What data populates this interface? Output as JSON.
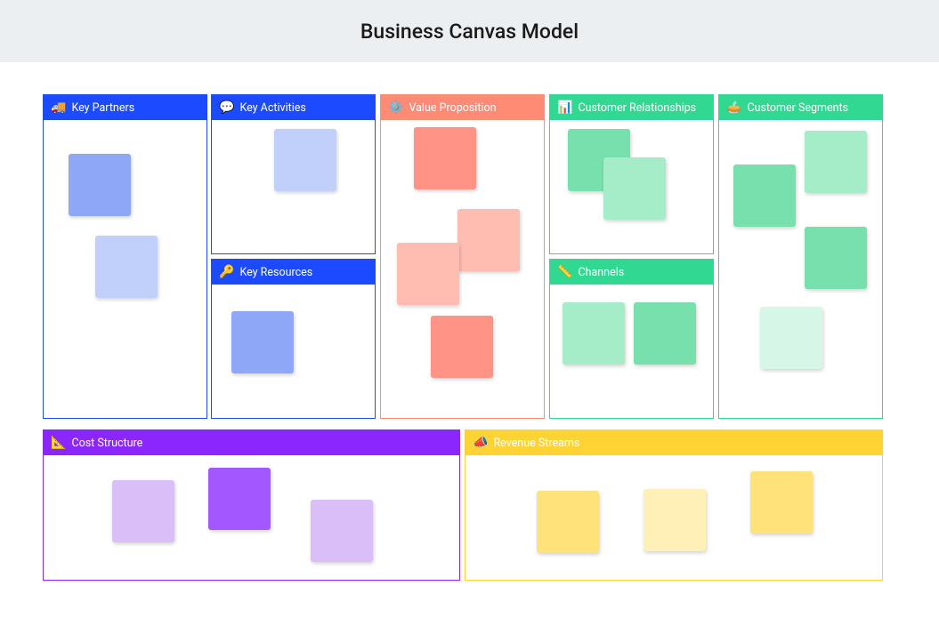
{
  "header": {
    "title": "Business Canvas Model"
  },
  "sections": {
    "key_partners": {
      "title": "Key Partners",
      "icon": "🚚"
    },
    "key_activities": {
      "title": "Key Activities",
      "icon": "💬"
    },
    "key_resources": {
      "title": "Key Resources",
      "icon": "🔑"
    },
    "value_proposition": {
      "title": "Value Proposition",
      "icon": "⚙️"
    },
    "customer_relationships": {
      "title": "Customer Relationships",
      "icon": "📊"
    },
    "channels": {
      "title": "Channels",
      "icon": "📏"
    },
    "customer_segments": {
      "title": "Customer Segments",
      "icon": "🥧"
    },
    "cost_structure": {
      "title": "Cost Structure",
      "icon": "📐"
    },
    "revenue_streams": {
      "title": "Revenue Streams",
      "icon": "📣"
    }
  },
  "sticky_colors": {
    "blue_dark": "#8ea7f7",
    "blue_light": "#c0d0fa",
    "coral_dark": "#ff9385",
    "coral_light": "#ffbdb2",
    "green_dark": "#78e0ad",
    "green_mid": "#a5ecc8",
    "green_light": "#d6f6e7",
    "purple_dark": "#a357ff",
    "purple_light": "#d9bef7",
    "yellow_dark": "#ffe37a",
    "yellow_light": "#fff0b8"
  }
}
